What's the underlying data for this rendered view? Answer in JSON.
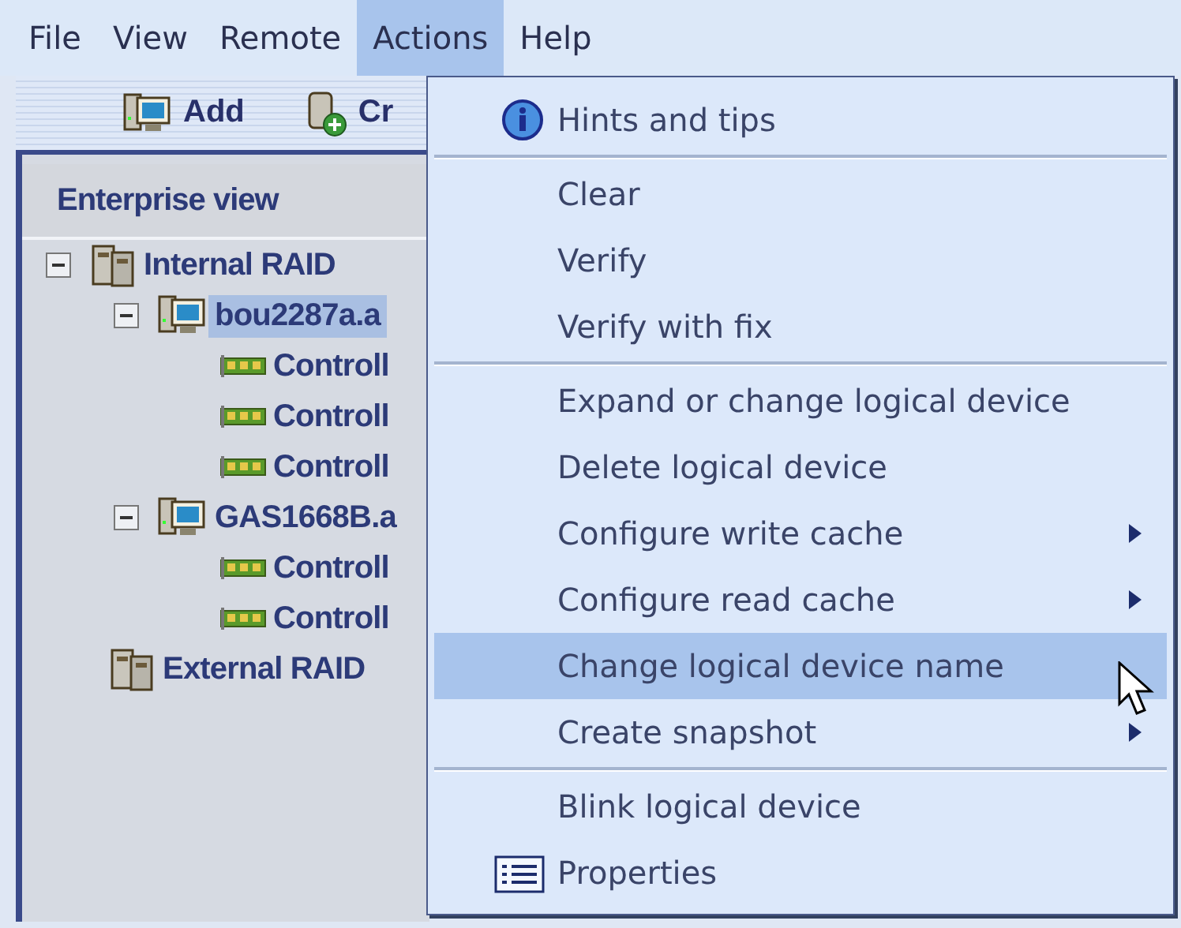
{
  "menubar": [
    {
      "label": "File",
      "selected": false
    },
    {
      "label": "View",
      "selected": false
    },
    {
      "label": "Remote",
      "selected": false
    },
    {
      "label": "Actions",
      "selected": true
    },
    {
      "label": "Help",
      "selected": false
    }
  ],
  "toolbar": [
    {
      "label": "Add",
      "kind": "host"
    },
    {
      "label": "Cr",
      "kind": "disk"
    }
  ],
  "panel": {
    "title": "Enterprise view"
  },
  "tree": [
    {
      "label": "Internal RAID",
      "kind": "raid",
      "expanded": true,
      "selected": false,
      "children": [
        {
          "label": "bou2287a.a",
          "kind": "host",
          "expanded": true,
          "selected": true,
          "children": [
            {
              "label": "Controll",
              "kind": "controller",
              "selected": false
            },
            {
              "label": "Controll",
              "kind": "controller",
              "selected": false
            },
            {
              "label": "Controll",
              "kind": "controller",
              "selected": false
            }
          ]
        },
        {
          "label": "GAS1668B.a",
          "kind": "host",
          "expanded": true,
          "selected": false,
          "children": [
            {
              "label": "Controll",
              "kind": "controller",
              "selected": false
            },
            {
              "label": "Controll",
              "kind": "controller",
              "selected": false
            }
          ]
        }
      ]
    },
    {
      "label": "External RAID",
      "kind": "raid",
      "selected": false
    }
  ],
  "menu": {
    "groups": [
      [
        {
          "label": "Hints and tips",
          "kind": "info",
          "submenu": false,
          "selected": false
        }
      ],
      [
        {
          "label": "Clear",
          "kind": "plain",
          "submenu": false,
          "selected": false
        },
        {
          "label": "Verify",
          "kind": "plain",
          "submenu": false,
          "selected": false
        },
        {
          "label": "Verify with fix",
          "kind": "plain",
          "submenu": false,
          "selected": false
        }
      ],
      [
        {
          "label": "Expand or change logical device",
          "kind": "plain",
          "submenu": false,
          "selected": false
        },
        {
          "label": "Delete logical device",
          "kind": "plain",
          "submenu": false,
          "selected": false
        },
        {
          "label": "Configure write cache",
          "kind": "plain",
          "submenu": true,
          "selected": false
        },
        {
          "label": "Configure read cache",
          "kind": "plain",
          "submenu": true,
          "selected": false
        },
        {
          "label": "Change logical device name",
          "kind": "plain",
          "submenu": false,
          "selected": true
        },
        {
          "label": "Create snapshot",
          "kind": "plain",
          "submenu": true,
          "selected": false
        }
      ],
      [
        {
          "label": "Blink logical device",
          "kind": "plain",
          "submenu": false,
          "selected": false
        },
        {
          "label": "Properties",
          "kind": "properties",
          "submenu": false,
          "selected": false
        }
      ]
    ]
  }
}
